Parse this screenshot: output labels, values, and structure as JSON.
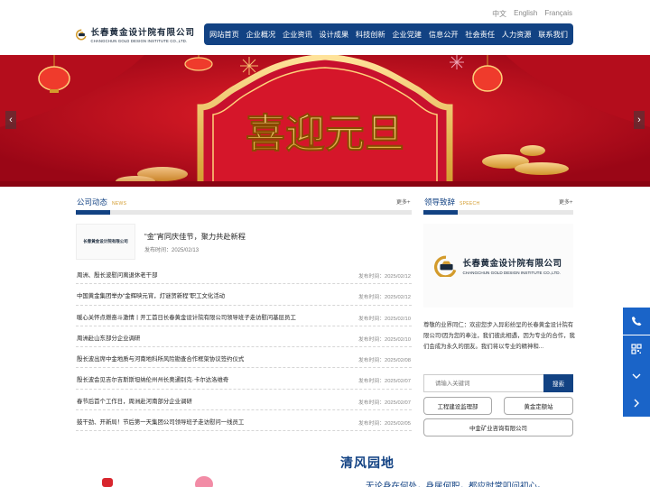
{
  "lang": [
    "中文",
    "English",
    "Français"
  ],
  "logo": {
    "cn": "长春黄金设计院有限公司",
    "en": "CHANGCHUN GOLD DESIGN INSTITUTE CO.,LTD."
  },
  "nav": [
    "网站首页",
    "企业概况",
    "企业资讯",
    "设计成果",
    "科技创新",
    "企业党建",
    "信息公开",
    "社会责任",
    "人力资源",
    "联系我们"
  ],
  "banner": {
    "headline": "喜迎元旦"
  },
  "news_section": {
    "title": "公司动态",
    "en": "NEWS",
    "more": "更多+"
  },
  "speech_section": {
    "title": "领导致辞",
    "en": "SPEECH",
    "more": "更多+"
  },
  "featured": {
    "thumb_text": "长春黄金设计院有限公司",
    "title": "“金”宵同庆佳节，聚力共赴新程",
    "date": "发布时间：2025/02/13"
  },
  "news": [
    {
      "title": "周洲、殷长波慰问离退休老干部",
      "date": "发布时间：2025/02/12"
    },
    {
      "title": "中国黄金集团举办“金辉映元宵，灯谜贺新程”职工文化活动",
      "date": "发布时间：2025/02/12"
    },
    {
      "title": "暖心关怀点燃奋斗激情丨开工首日长春黄金设计院有限公司领导班子走访慰问基层员工",
      "date": "发布时间：2025/02/10"
    },
    {
      "title": "周洲赴山东部分企业调研",
      "date": "发布时间：2025/02/10"
    },
    {
      "title": "殷长波出席中金地质与河南地科所风险勘查合作框架协议签约仪式",
      "date": "发布时间：2025/02/08"
    },
    {
      "title": "殷长波会见吉尔吉斯斯坦纳伦州州长奥通别克·卡尔达洛维奇",
      "date": "发布时间：2025/02/07"
    },
    {
      "title": "春节后首个工作日，周洲赴河南部分企业调研",
      "date": "发布时间：2025/02/07"
    },
    {
      "title": "鼓干劲、开新局！节后第一天集团公司领导班子走访慰问一线员工",
      "date": "发布时间：2025/02/05"
    }
  ],
  "speech": {
    "text": "尊敬的业界同仁：欢迎您步入异彩纷呈的长春黄金设计院有限公司!因为您的奉注，我们彼此相遇，因为专业的合作，我们会成为永久的朋友。我们将以专业的精神和..."
  },
  "search": {
    "placeholder": "请输入关键词",
    "button": "搜索"
  },
  "links": [
    "工程建设监理部",
    "黄金定额站",
    "中金矿业咨询有限公司"
  ],
  "qingfeng": {
    "title": "清风园地",
    "subtitle": "无论身在何处，身居何职，都应时常叩问初心。"
  },
  "side_icons": [
    "phone-icon",
    "qrcode-icon",
    "chevron-down-icon",
    "chevron-right-icon"
  ],
  "colors": {
    "primary": "#124283",
    "banner_red": "#c8102e",
    "gold": "#d39b2c",
    "side_blue": "#1a64c8"
  }
}
